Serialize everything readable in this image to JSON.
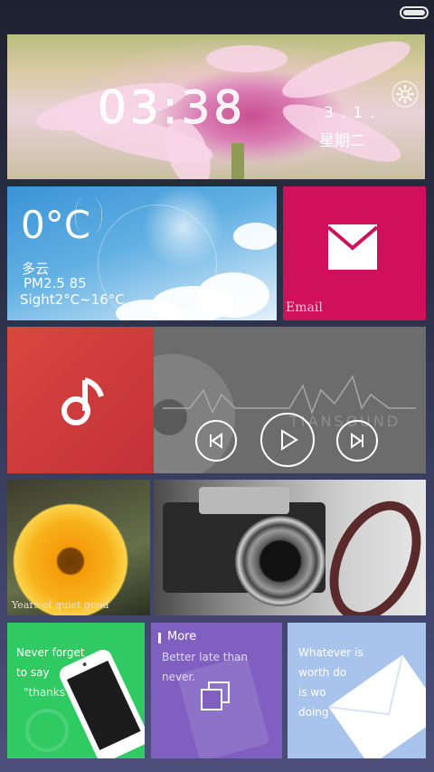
{
  "status": {
    "battery_level": 1.0
  },
  "clock": {
    "time": "03:38",
    "date": "3.1.",
    "weekday": "星期二"
  },
  "weather": {
    "temperature": "0°C",
    "condition": "多云",
    "pm": "PM2.5 85",
    "range": "Sight2°C~16°C"
  },
  "email": {
    "label": "Email"
  },
  "player": {
    "watermark": "TIANSOUND"
  },
  "photos": {
    "caption": "Years of quiet good"
  },
  "notes": {
    "green": [
      "Never forget",
      "to say",
      "\"thanks\""
    ],
    "more_label": "More",
    "purple": [
      "Better late than",
      "never."
    ],
    "blue": [
      "Whatever is",
      "worth do",
      "is wo",
      "doing"
    ]
  },
  "colors": {
    "email": "#d0105a",
    "music": "#d9473e",
    "player": "#6c6c6c",
    "green": "#2fca62",
    "purple": "#7f5fc0",
    "blue": "#a8c4ec"
  },
  "icons": [
    "battery-icon",
    "settings-gear-icon",
    "sun-icon",
    "mail-icon",
    "music-note-icon",
    "previous-icon",
    "play-icon",
    "next-icon",
    "phone-icon",
    "copy-icon",
    "envelope-icon"
  ]
}
